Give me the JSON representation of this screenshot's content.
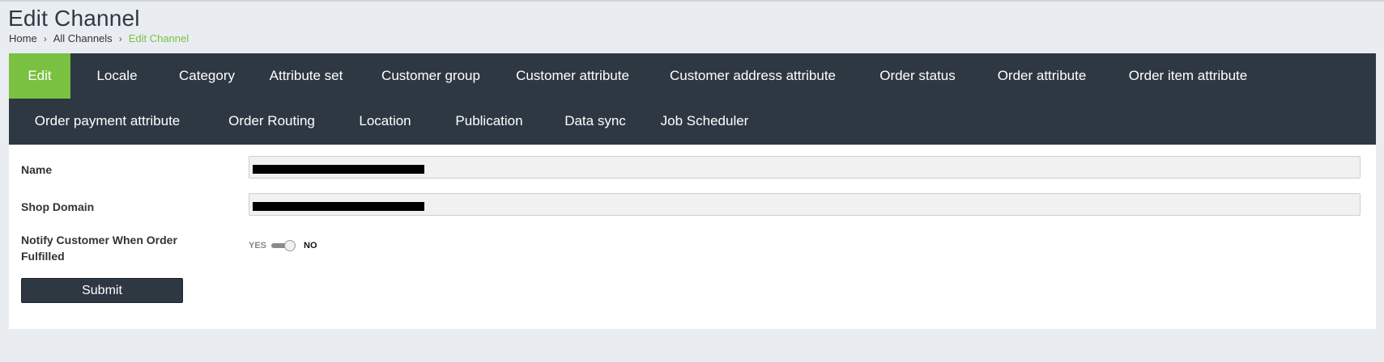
{
  "page": {
    "title": "Edit Channel"
  },
  "breadcrumb": {
    "items": [
      "Home",
      "All Channels",
      "Edit Channel"
    ],
    "separator": "›"
  },
  "tabs": {
    "active_color": "#7ac142",
    "bar_color": "#2e3842",
    "items": [
      {
        "label": "Edit",
        "active": true
      },
      {
        "label": "Locale"
      },
      {
        "label": "Category"
      },
      {
        "label": "Attribute set"
      },
      {
        "label": "Customer group"
      },
      {
        "label": "Customer attribute"
      },
      {
        "label": "Customer address attribute"
      },
      {
        "label": "Order status"
      },
      {
        "label": "Order attribute"
      },
      {
        "label": "Order item attribute"
      },
      {
        "label": "Order payment attribute"
      },
      {
        "label": "Order Routing"
      },
      {
        "label": "Location"
      },
      {
        "label": "Publication"
      },
      {
        "label": "Data sync"
      },
      {
        "label": "Job Scheduler"
      }
    ]
  },
  "form": {
    "name_label": "Name",
    "name_value": "",
    "shop_domain_label": "Shop Domain",
    "shop_domain_value": "",
    "notify_label": "Notify Customer When Order Fulfilled",
    "notify_yes": "YES",
    "notify_no": "NO",
    "notify_state": "NO",
    "submit_label": "Submit"
  }
}
